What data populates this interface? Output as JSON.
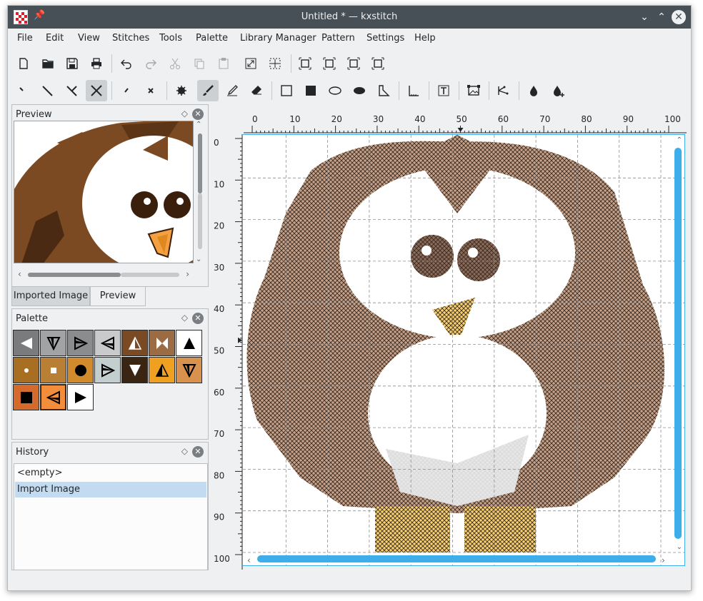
{
  "window": {
    "title": "Untitled * — kxstitch"
  },
  "menu": [
    "File",
    "Edit",
    "View",
    "Stitches",
    "Tools",
    "Palette",
    "Library Manager",
    "Pattern",
    "Settings",
    "Help"
  ],
  "icons": {
    "toolbar1": [
      "new-icon",
      "open-icon",
      "save-icon",
      "print-icon",
      "undo-icon",
      "redo-icon",
      "cut-icon",
      "copy-icon",
      "paste-icon",
      "fit-page-icon",
      "select-all-icon",
      "fit-width-icon",
      "fit-height-icon",
      "actual-size-icon"
    ],
    "toolbar2": [
      "quarter-stitch-icon",
      "half-stitch-icon",
      "three-quarter-stitch-icon",
      "full-stitch-icon",
      "small-half-stitch-icon",
      "small-full-stitch-icon",
      "french-knot-icon",
      "paint-icon",
      "draw-icon",
      "erase-icon",
      "rectangle-outline-icon",
      "rectangle-fill-icon",
      "ellipse-outline-icon",
      "ellipse-fill-icon",
      "polygon-icon",
      "backstitch-icon",
      "text-icon",
      "alphabet-icon",
      "alignment-icon",
      "color-picker-icon",
      "add-color-icon"
    ]
  },
  "preview_dock": {
    "title": "Preview"
  },
  "tabs": {
    "imported": "Imported Image",
    "preview": "Preview"
  },
  "palette_dock": {
    "title": "Palette",
    "cells": [
      {
        "color": "#7a7b7d",
        "symbol": "tri-left-fill",
        "fg": "#ffffff"
      },
      {
        "color": "#a2a3a5",
        "symbol": "tri-down-outline",
        "fg": "#000000"
      },
      {
        "color": "#8b8c8e",
        "symbol": "tri-right-outline",
        "fg": "#000000"
      },
      {
        "color": "#c9cacc",
        "symbol": "tri-left-outline",
        "fg": "#000000"
      },
      {
        "color": "#7a4a25",
        "symbol": "tri-up-half",
        "fg": "#ffffff"
      },
      {
        "color": "#9b6b43",
        "symbol": "bowtie",
        "fg": "#ffffff"
      },
      {
        "color": "#ffffff",
        "symbol": "tri-up-fill",
        "fg": "#000000"
      },
      {
        "color": "#a86f22",
        "symbol": "dot-small",
        "fg": "#ffffff"
      },
      {
        "color": "#b98035",
        "symbol": "square-small",
        "fg": "#ffffff"
      },
      {
        "color": "#d18a2c",
        "symbol": "circle-fill",
        "fg": "#000000"
      },
      {
        "color": "#c3cfcf",
        "symbol": "tri-right-outline",
        "fg": "#000000"
      },
      {
        "color": "#3a2412",
        "symbol": "tri-down-fill",
        "fg": "#ffffff"
      },
      {
        "color": "#f0a020",
        "symbol": "tri-up-half",
        "fg": "#000000"
      },
      {
        "color": "#d8924e",
        "symbol": "tri-down-outline",
        "fg": "#000000"
      },
      {
        "color": "#d46b2d",
        "symbol": "square-fill",
        "fg": "#000000"
      },
      {
        "color": "#f28d3c",
        "symbol": "tri-left-outline",
        "fg": "#000000"
      },
      {
        "color": "#ffffff",
        "symbol": "tri-right-fill",
        "fg": "#000000"
      }
    ]
  },
  "history_dock": {
    "title": "History",
    "items": [
      "<empty>",
      "Import Image"
    ],
    "selected": 1
  },
  "ruler": {
    "h_labels": [
      "0",
      "10",
      "20",
      "30",
      "40",
      "50",
      "60",
      "70",
      "80",
      "90",
      "100"
    ],
    "v_labels": [
      "0",
      "10",
      "20",
      "30",
      "40",
      "50",
      "60",
      "70",
      "80",
      "90",
      "100"
    ]
  },
  "colors": {
    "accent": "#3daee9",
    "titlebar": "#475057",
    "brown": "#8a5a3a",
    "light_brown": "#c6a28a"
  }
}
